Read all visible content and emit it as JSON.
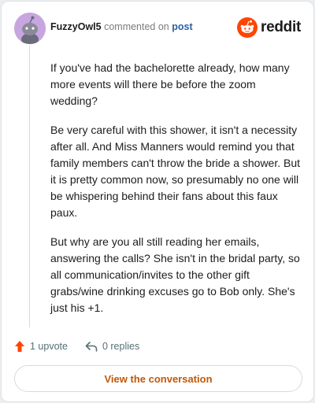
{
  "comment": {
    "username": "FuzzyOwl5",
    "action_text": "commented on",
    "target_link": "post",
    "paragraphs": [
      "If you've had the bachelorette already, how many more events will there be before the zoom wedding?",
      "Be very careful with this shower, it isn't a necessity after all. And Miss Manners would remind you that family members can't throw the bride a shower. But it is pretty common now, so presumably no one will be whispering behind their fans about this faux paux.",
      "But why are you all still reading her emails, answering the calls? She isn't in the bridal party, so all communication/invites to the other gift grabs/wine drinking excuses go to Bob only. She's just his +1."
    ]
  },
  "brand": {
    "wordmark": "reddit",
    "color": "#ff4500"
  },
  "footer": {
    "upvotes": "1 upvote",
    "replies": "0 replies"
  },
  "cta": {
    "label": "View the conversation",
    "color": "#c0580a"
  },
  "icons": [
    "avatar",
    "reddit-logo-icon",
    "upvote-arrow-icon",
    "reply-icon"
  ]
}
